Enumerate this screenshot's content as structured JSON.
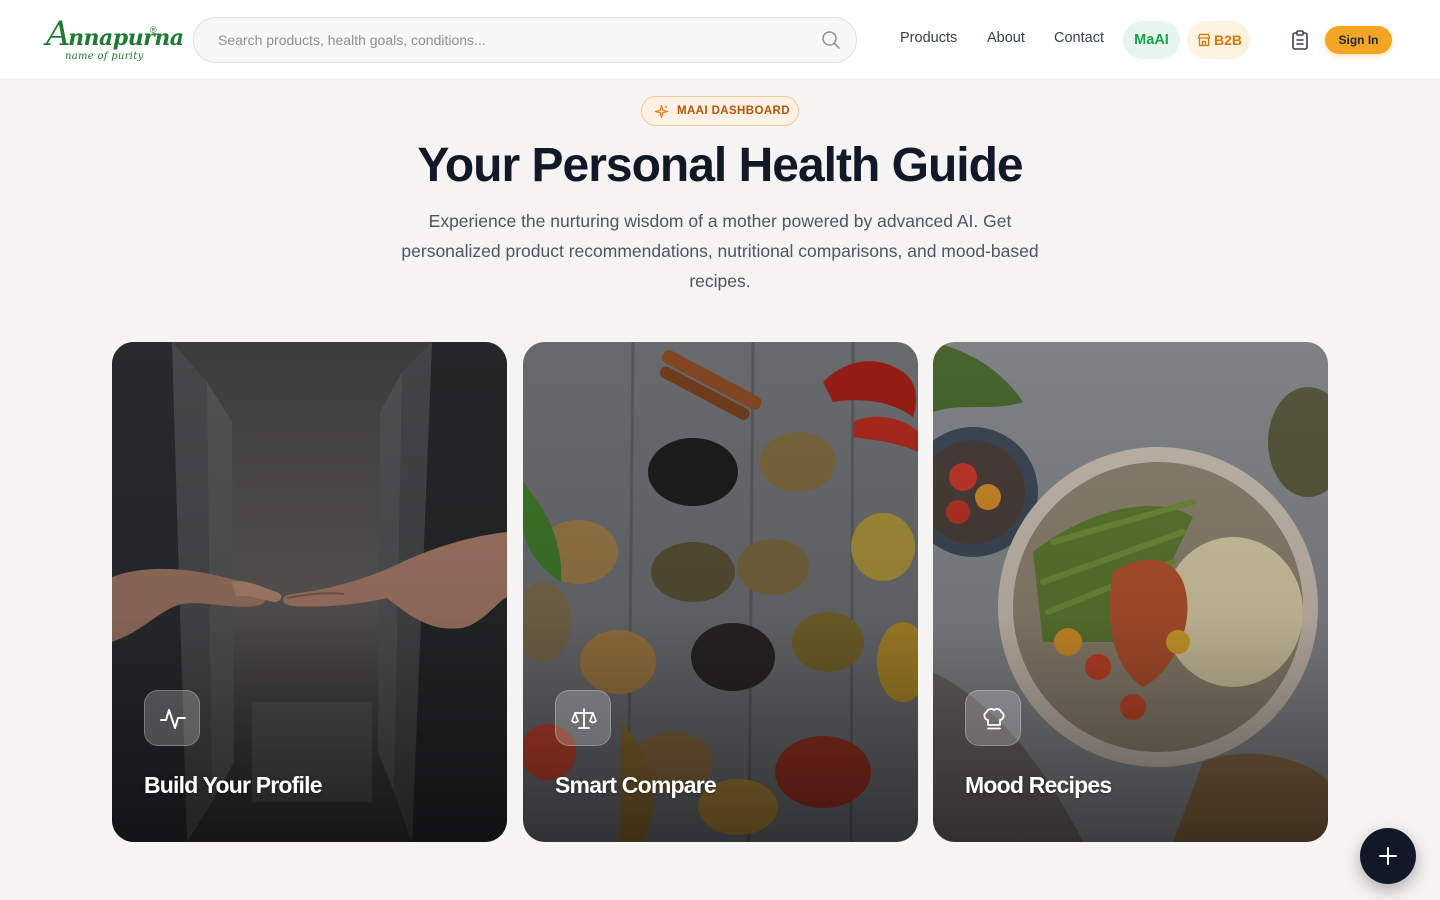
{
  "brand": {
    "name_initial": "A",
    "name_rest": "nnapurna",
    "registered": "®",
    "tagline": "name of purity",
    "color": "#1f7a33"
  },
  "search": {
    "placeholder": "Search products, health goals, conditions...",
    "icon": "search-icon"
  },
  "nav": {
    "products": "Products",
    "about": "About",
    "contact": "Contact",
    "maai": "MaAI",
    "b2b": "B2B",
    "b2b_icon": "store-icon",
    "clipboard_icon": "clipboard-icon",
    "sign_in": "Sign In"
  },
  "hero": {
    "badge": "MAAI DASHBOARD",
    "badge_icon": "sparkle-icon",
    "title": "Your Personal Health Guide",
    "subtitle": "Experience the nurturing wisdom of a mother powered by advanced AI. Get personalized product recommendations, nutritional comparisons, and mood-based recipes."
  },
  "cards": [
    {
      "title": "Build Your Profile",
      "icon": "activity-icon"
    },
    {
      "title": "Smart Compare",
      "icon": "scale-icon"
    },
    {
      "title": "Mood Recipes",
      "icon": "chef-hat-icon"
    }
  ],
  "fab": {
    "icon": "plus-icon"
  },
  "colors": {
    "accent_orange": "#f5a524",
    "accent_green": "#16a34a",
    "badge_text": "#b45309",
    "page_bg": "#f5f4f2",
    "fab_bg": "#111827"
  }
}
